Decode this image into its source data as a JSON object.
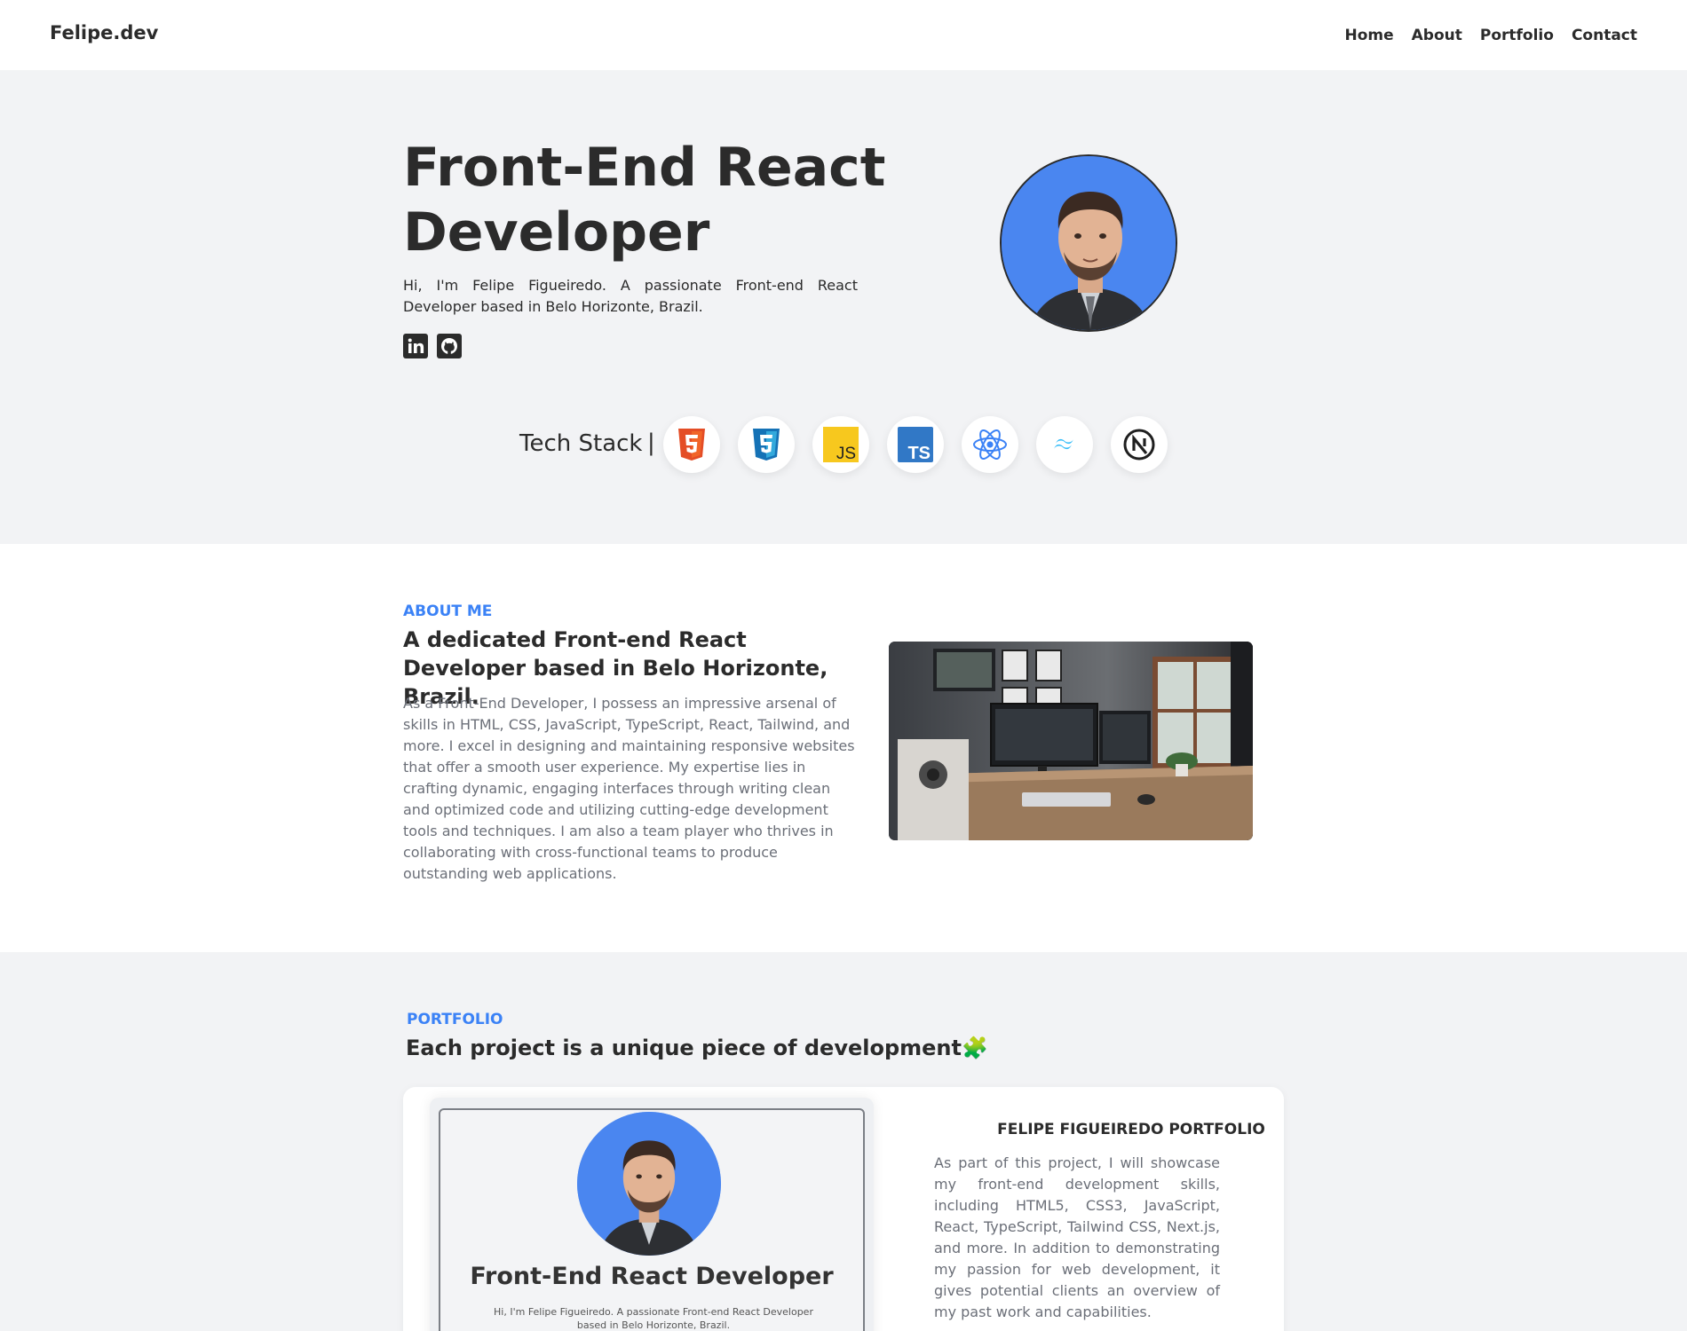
{
  "header": {
    "logo": "Felipe.dev",
    "nav": [
      "Home",
      "About",
      "Portfolio",
      "Contact"
    ]
  },
  "hero": {
    "title": "Front-End React Developer",
    "description": "Hi, I'm Felipe Figueiredo. A passionate Front-end React Developer based in Belo Horizonte, Brazil.",
    "social_icons": [
      "linkedin-icon",
      "github-icon"
    ],
    "tech_stack_label": "Tech Stack",
    "tech_stack_separator": "|",
    "tech_icons": [
      "html5-icon",
      "css3-icon",
      "javascript-icon",
      "typescript-icon",
      "react-icon",
      "tailwind-icon",
      "nextjs-icon"
    ],
    "tech_badges": {
      "js": "JS",
      "ts": "TS"
    }
  },
  "about": {
    "kicker": "ABOUT ME",
    "heading": "A dedicated Front-end React Developer based in Belo Horizonte, Brazil.",
    "text": "As a Front-End Developer, I possess an impressive arsenal of skills in HTML, CSS, JavaScript, TypeScript, React, Tailwind, and more. I excel in designing and maintaining responsive websites that offer a smooth user experience. My expertise lies in crafting dynamic, engaging interfaces through writing clean and optimized code and utilizing cutting-edge development tools and techniques. I am also a team player who thrives in collaborating with cross-functional teams to produce outstanding web applications."
  },
  "portfolio": {
    "kicker": "PORTFOLIO",
    "heading": "Each project is a unique piece of development🧩",
    "project": {
      "title": "FELIPE FIGUEIREDO PORTFOLIO",
      "description": "As part of this project, I will showcase my front-end development skills, including HTML5, CSS3, JavaScript, React, TypeScript, Tailwind CSS, Next.js, and more. In addition to demonstrating my passion for web development, it gives potential clients an overview of my past work and capabilities.",
      "screenshot_title": "Front-End React Developer",
      "screenshot_desc": "Hi, I'm Felipe Figueiredo. A passionate Front-end React Developer based in Belo Horizonte, Brazil."
    }
  },
  "colors": {
    "accent": "#3b82f6",
    "text": "#2b2b2b",
    "muted": "#6b6f78",
    "background": "#f2f3f5"
  }
}
